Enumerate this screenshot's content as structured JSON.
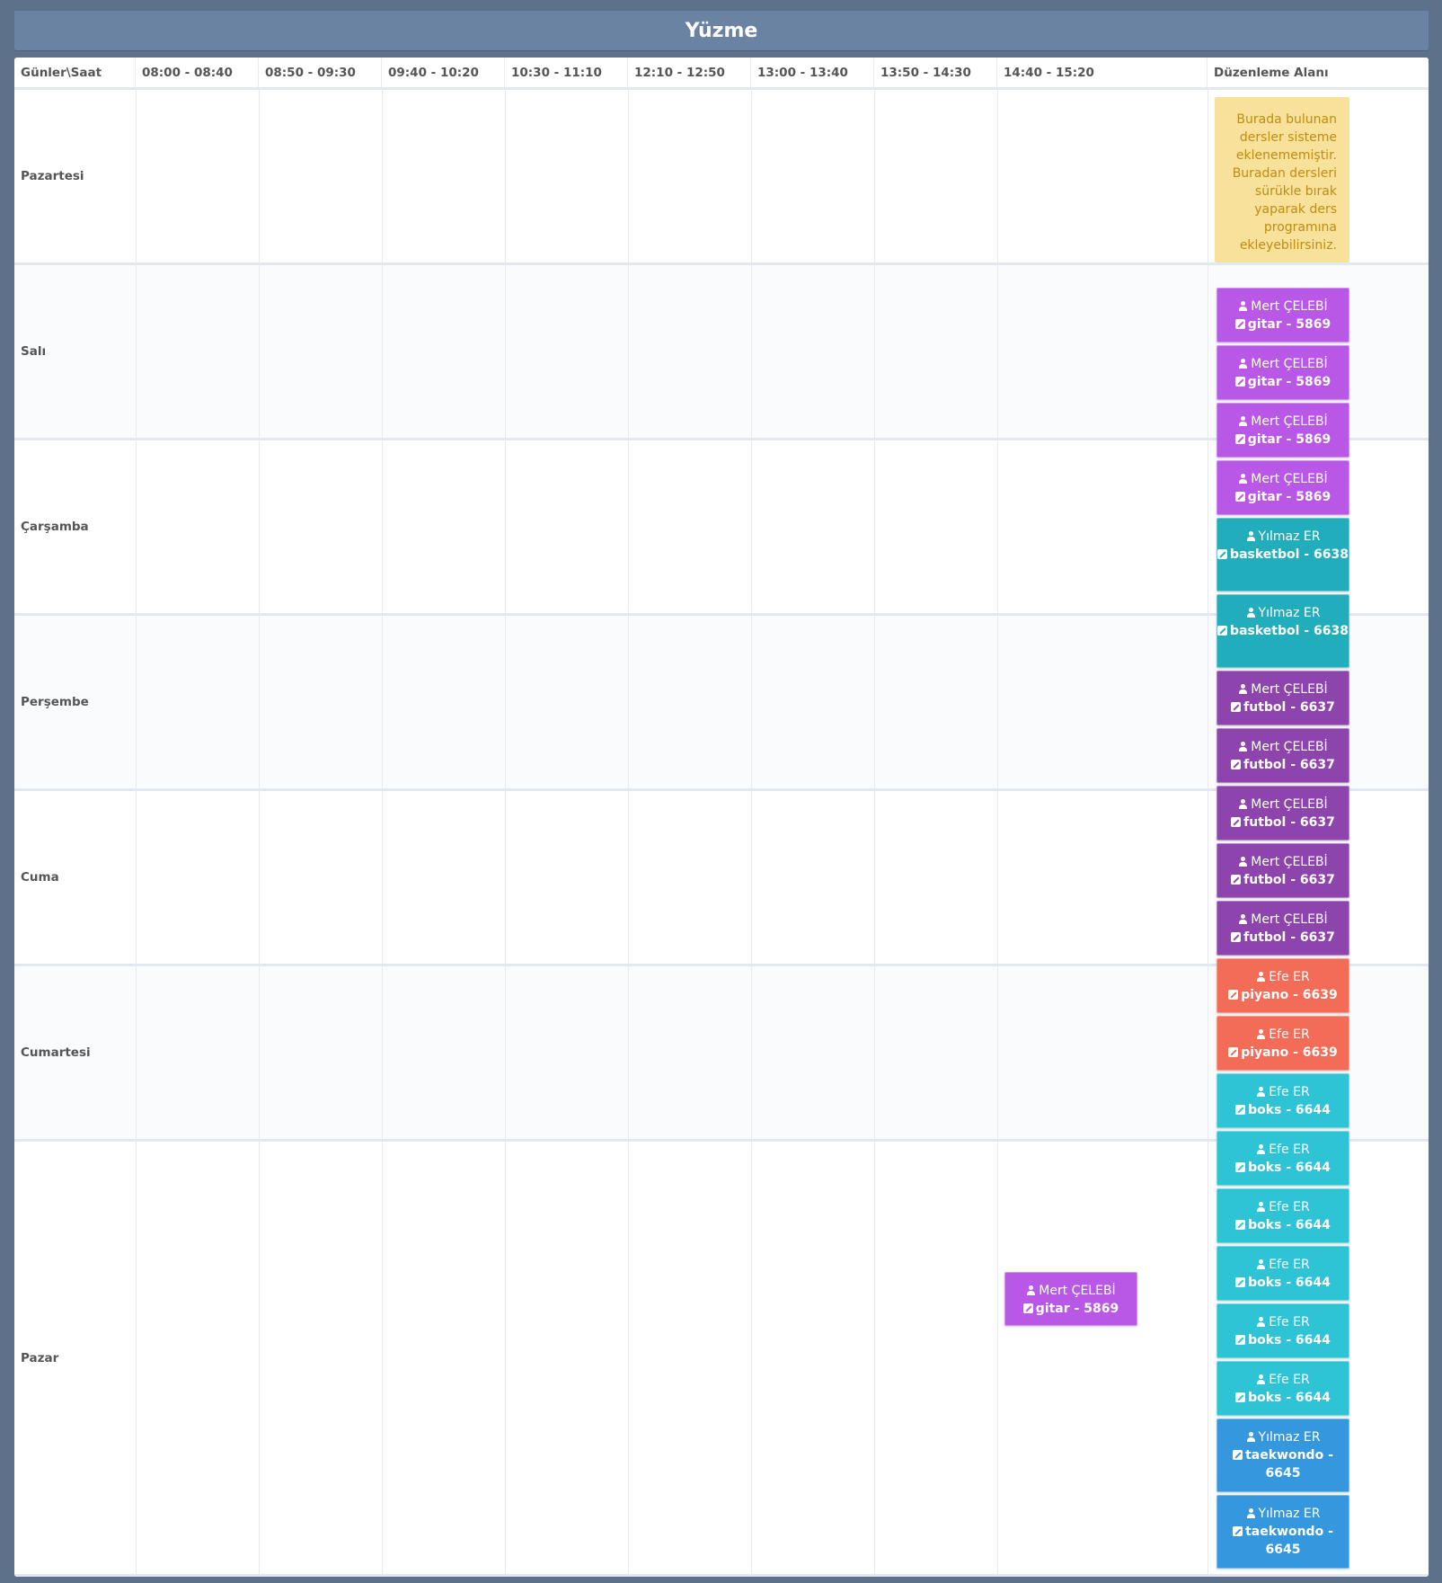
{
  "page": {
    "title": "Yüzme"
  },
  "header": {
    "corner": "Günler\\Saat",
    "slots": [
      "08:00 - 08:40",
      "08:50 - 09:30",
      "09:40 - 10:20",
      "10:30 - 11:10",
      "12:10 - 12:50",
      "13:00 - 13:40",
      "13:50 - 14:30",
      "14:40 - 15:20"
    ],
    "edit_area": "Düzenleme Alanı"
  },
  "days": [
    "Pazartesi",
    "Salı",
    "Çarşamba",
    "Perşembe",
    "Cuma",
    "Cumartesi",
    "Pazar"
  ],
  "edit_area_note": "Burada bulunan dersler sisteme eklenememiştir. Buradan dersleri sürükle bırak yaparak ders programına ekleyebilirsiniz.",
  "scheduled": [
    {
      "teacher": "Mert ÇELEBİ",
      "course": "gitar - 5869",
      "color": "#b957e6",
      "day": "Pazar",
      "slot": "14:40 - 15:20"
    }
  ],
  "unassigned": [
    {
      "teacher": "Mert ÇELEBİ",
      "course": "gitar - 5869",
      "color": "#b957e6"
    },
    {
      "teacher": "Mert ÇELEBİ",
      "course": "gitar - 5869",
      "color": "#b957e6"
    },
    {
      "teacher": "Mert ÇELEBİ",
      "course": "gitar - 5869",
      "color": "#b957e6"
    },
    {
      "teacher": "Mert ÇELEBİ",
      "course": "gitar - 5869",
      "color": "#b957e6"
    },
    {
      "teacher": "Yılmaz ER",
      "course": "basketbol - 6638",
      "color": "#22adbc"
    },
    {
      "teacher": "Yılmaz ER",
      "course": "basketbol - 6638",
      "color": "#22adbc"
    },
    {
      "teacher": "Mert ÇELEBİ",
      "course": "futbol - 6637",
      "color": "#8e44ad"
    },
    {
      "teacher": "Mert ÇELEBİ",
      "course": "futbol - 6637",
      "color": "#8e44ad"
    },
    {
      "teacher": "Mert ÇELEBİ",
      "course": "futbol - 6637",
      "color": "#8e44ad"
    },
    {
      "teacher": "Mert ÇELEBİ",
      "course": "futbol - 6637",
      "color": "#8e44ad"
    },
    {
      "teacher": "Mert ÇELEBİ",
      "course": "futbol - 6637",
      "color": "#8e44ad"
    },
    {
      "teacher": "Efe ER",
      "course": "piyano - 6639",
      "color": "#f26c57"
    },
    {
      "teacher": "Efe ER",
      "course": "piyano - 6639",
      "color": "#f26c57"
    },
    {
      "teacher": "Efe ER",
      "course": "boks - 6644",
      "color": "#2ec4d6"
    },
    {
      "teacher": "Efe ER",
      "course": "boks - 6644",
      "color": "#2ec4d6"
    },
    {
      "teacher": "Efe ER",
      "course": "boks - 6644",
      "color": "#2ec4d6"
    },
    {
      "teacher": "Efe ER",
      "course": "boks - 6644",
      "color": "#2ec4d6"
    },
    {
      "teacher": "Efe ER",
      "course": "boks - 6644",
      "color": "#2ec4d6"
    },
    {
      "teacher": "Efe ER",
      "course": "boks - 6644",
      "color": "#2ec4d6"
    },
    {
      "teacher": "Yılmaz ER",
      "course": "taekwondo - 6645",
      "color": "#3598de"
    },
    {
      "teacher": "Yılmaz ER",
      "course": "taekwondo - 6645",
      "color": "#3598de"
    }
  ],
  "icons": {
    "teacher": "user-icon",
    "course": "edit-icon"
  }
}
